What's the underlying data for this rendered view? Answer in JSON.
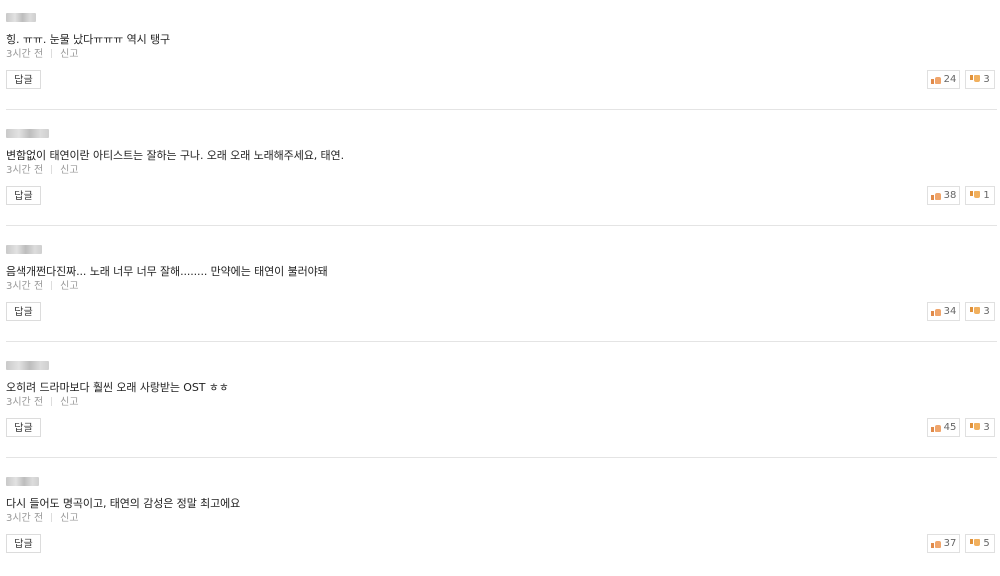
{
  "comments": [
    {
      "text": "힝. ㅠㅠ. 눈물 났다ㅠㅠㅠ 역시 탱구",
      "time": "3시간 전",
      "report": "신고",
      "reply": "답글",
      "likes": "24",
      "dislikes": "3"
    },
    {
      "text": "변함없이 태연이란 아티스트는 잘하는 구나. 오래 오래 노래해주세요, 태연.",
      "time": "3시간 전",
      "report": "신고",
      "reply": "답글",
      "likes": "38",
      "dislikes": "1"
    },
    {
      "text": "음색개쩐다진짜... 노래 너무 너무 잘해........ 만약에는 태연이 불러야돼",
      "time": "3시간 전",
      "report": "신고",
      "reply": "답글",
      "likes": "34",
      "dislikes": "3"
    },
    {
      "text": "오히려 드라마보다 훨씬 오래 사랑받는 OST ㅎㅎ",
      "time": "3시간 전",
      "report": "신고",
      "reply": "답글",
      "likes": "45",
      "dislikes": "3"
    },
    {
      "text": "다시 들어도 명곡이고, 태연의 감성은 정말 최고에요",
      "time": "3시간 전",
      "report": "신고",
      "reply": "답글",
      "likes": "37",
      "dislikes": "5"
    }
  ],
  "colors": {
    "text": "#222222",
    "meta": "#999999",
    "divider": "#e4e4e4",
    "thumb_up": "#f0a56b",
    "thumb_down": "#f1b05e"
  },
  "icons": {
    "like": "thumb-up-icon",
    "dislike": "thumb-down-icon"
  }
}
